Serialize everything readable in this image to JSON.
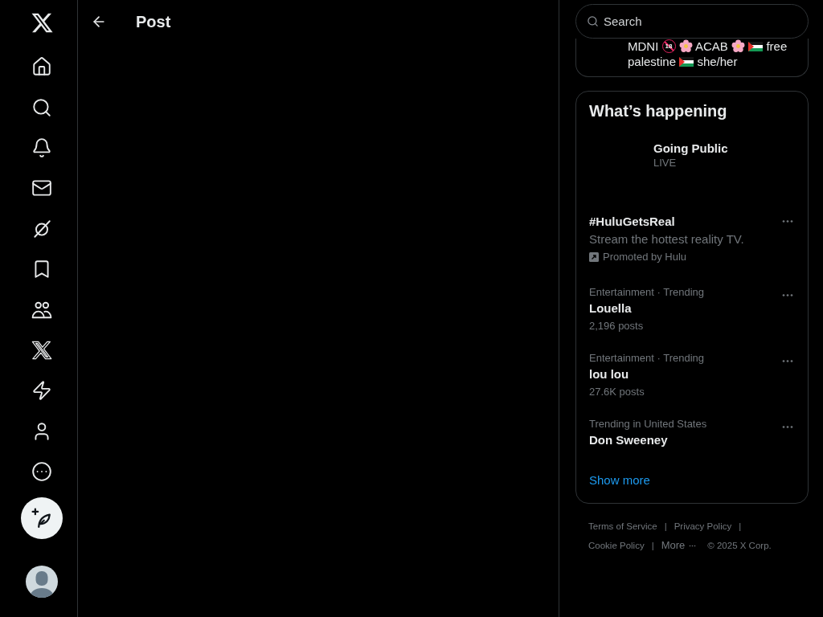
{
  "sidebar": {
    "nav": [
      {
        "kind": "home",
        "selected": false
      },
      {
        "kind": "explore",
        "selected": false
      },
      {
        "kind": "notifications",
        "selected": false
      },
      {
        "kind": "messages",
        "selected": false
      },
      {
        "kind": "grok",
        "selected": false
      },
      {
        "kind": "bookmarks",
        "selected": false
      },
      {
        "kind": "communities",
        "selected": false
      },
      {
        "kind": "premium",
        "selected": false
      },
      {
        "kind": "verified",
        "selected": false
      },
      {
        "kind": "profile",
        "selected": false
      },
      {
        "kind": "more",
        "selected": false
      }
    ]
  },
  "main": {
    "title": "Post"
  },
  "search": {
    "placeholder": "Search"
  },
  "profile_card": {
    "bio": [
      {
        "kind": "text",
        "text": "MDNI"
      },
      {
        "kind": "age",
        "text": "18"
      },
      {
        "kind": "blossom"
      },
      {
        "kind": "text",
        "text": "ACAB"
      },
      {
        "kind": "blossom"
      },
      {
        "kind": "flag"
      },
      {
        "kind": "text",
        "text": "free palestine"
      },
      {
        "kind": "flag"
      },
      {
        "kind": "text",
        "text": "she/her"
      }
    ]
  },
  "trends": {
    "title": "What’s happening",
    "event": {
      "title": "Going Public",
      "status": "LIVE"
    },
    "items": [
      {
        "kind": "promoted",
        "title": "#HuluGetsReal",
        "description": "Stream the hottest reality TV.",
        "promoted_by": "Promoted by Hulu"
      },
      {
        "kind": "trend",
        "category": "Entertainment · Trending",
        "title": "Louella",
        "posts": "2,196 posts"
      },
      {
        "kind": "trend",
        "category": "Entertainment · Trending",
        "title": "lou lou",
        "posts": "27.6K posts"
      },
      {
        "kind": "trend",
        "category": "Trending in United States",
        "title": "Don Sweeney"
      }
    ],
    "show_more": "Show more"
  },
  "footer": [
    {
      "kind": "link",
      "text": "Terms of Service"
    },
    {
      "kind": "separator",
      "text": "|"
    },
    {
      "kind": "link",
      "text": "Privacy Policy"
    },
    {
      "kind": "separator",
      "text": "|"
    },
    {
      "kind": "link",
      "text": "Cookie Policy"
    },
    {
      "kind": "separator",
      "text": "|"
    },
    {
      "kind": "more",
      "text": "More"
    },
    {
      "kind": "text",
      "text": "© 2025 X Corp."
    }
  ]
}
